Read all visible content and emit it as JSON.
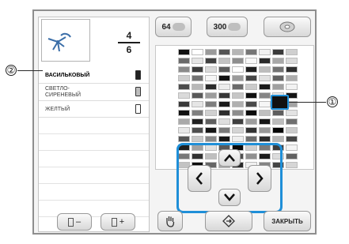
{
  "counter": {
    "current": "4",
    "total": "6"
  },
  "threads": [
    {
      "label": "ВАСИЛЬКОВЫЙ",
      "selected": true,
      "spool_color": "#222222"
    },
    {
      "label": "СВЕТЛО-СИРЕНЕВЫЙ",
      "selected": false,
      "spool_color": "#bdbdbd"
    },
    {
      "label": "ЖЕЛТЫЙ",
      "selected": false,
      "spool_color": "#ffffff"
    }
  ],
  "tabs": {
    "tab64": "64",
    "tab300": "300"
  },
  "buttons": {
    "close": "ЗАКРЫТЬ",
    "minus": "–",
    "plus": "+"
  },
  "callouts": {
    "one": "①",
    "two": "②"
  },
  "colors": {
    "accent": "#1f8fd8"
  },
  "palette": {
    "rows": [
      [
        "#111111",
        "#ffffff",
        "#9a9a9a",
        "#555555",
        "#b5b5b5",
        "#767676",
        "#f0f0f0",
        "#3a3a3a",
        "#cfcfcf"
      ],
      [
        "#6b6b6b",
        "#e4e4e4",
        "#404040",
        "#c2c2c2",
        "#8e8e8e",
        "#f8f8f8",
        "#2a2a2a",
        "#a8a8a8",
        "#dadada"
      ],
      [
        "#8b8b8b",
        "#3c3c3c",
        "#d9d9d9",
        "#5c5c5c",
        "#ffffff",
        "#1e1e1e",
        "#bdbdbd",
        "#727272",
        "#2f2f2f"
      ],
      [
        "#cfcfcf",
        "#737373",
        "#f5f5f5",
        "#121212",
        "#9b9b9b",
        "#454545",
        "#e1e1e1",
        "#636363",
        "#adadad"
      ],
      [
        "#4c4c4c",
        "#b8b8b8",
        "#2b2b2b",
        "#ededed",
        "#6a6a6a",
        "#cacaca",
        "#1b1b1b",
        "#a0a0a0",
        "#f2f2f2"
      ],
      [
        "#dadada",
        "#595959",
        "#9c9c9c",
        "#363636",
        "#c6c6c6",
        "#0f0f0f",
        "#858585",
        "#e9e9e9",
        "#131313"
      ],
      [
        "#393939",
        "#e6e6e6",
        "#7d7d7d",
        "#1a1a1a",
        "#b0b0b0",
        "#4a4a4a",
        "#f6f6f6",
        "#262626",
        "#a4a4a4"
      ],
      [
        "#111111",
        "#7f7f7f",
        "#d0d0d0",
        "#2d2d2d",
        "#8d8d8d",
        "#0c0c0c",
        "#c0c0c0",
        "#5e5e5e",
        "#e3e3e3"
      ],
      [
        "#a9a9a9",
        "#202020",
        "#5f5f5f",
        "#dedede",
        "#3f3f3f",
        "#9e9e9e",
        "#161616",
        "#bcbcbc",
        "#6e6e6e"
      ],
      [
        "#e8e8e8",
        "#4f4f4f",
        "#151515",
        "#7a7a7a",
        "#d4d4d4",
        "#333333",
        "#989898",
        "#050505",
        "#cbcbcb"
      ],
      [
        "#555555",
        "#c9c9c9",
        "#8a8a8a",
        "#171717",
        "#eeeeee",
        "#6d6d6d",
        "#2c2c2c",
        "#b7b7b7",
        "#474747"
      ],
      [
        "#1f1f1f",
        "#a2a2a2",
        "#e0e0e0",
        "#585858",
        "#0a0a0a",
        "#cfcfcf",
        "#7b7b7b",
        "#3d3d3d",
        "#f4f4f4"
      ],
      [
        "#777777",
        "#313131",
        "#bfbfbf",
        "#e5e5e5",
        "#4e4e4e",
        "#909090",
        "#1c1c1c",
        "#dcdcdc",
        "#626262"
      ],
      [
        "#c3c3c3",
        "#0e0e0e",
        "#666666",
        "#a7a7a7",
        "#292929",
        "#f1f1f1",
        "#848484",
        "#444444",
        "#d6d6d6"
      ]
    ]
  }
}
